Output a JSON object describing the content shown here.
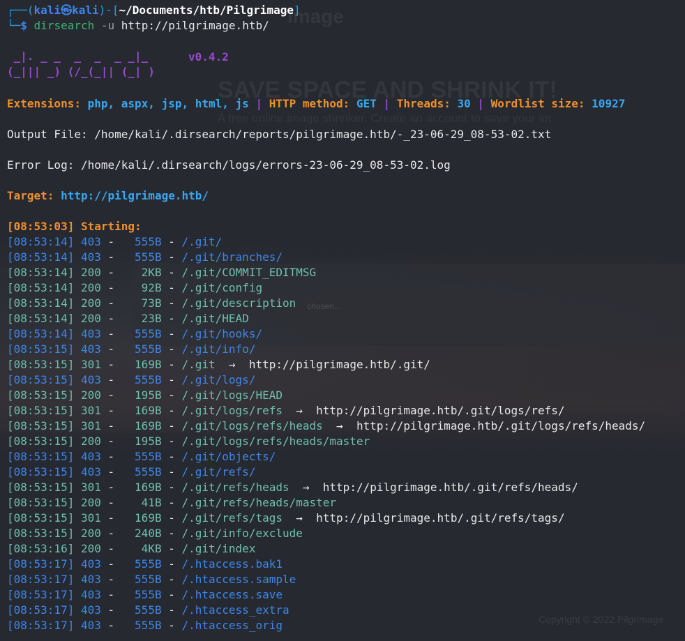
{
  "background": {
    "brand": "image",
    "heading": "SAVE SPACE AND SHRINK IT!",
    "subheading": "A free online image shrinker. Create an account to save your im",
    "file_hint": "chosen...",
    "copyright": "Copyright © 2022 Pilgrimage"
  },
  "prompt": {
    "box_top": "┌──(",
    "user_host": "kali㉿kali",
    "mid": ")-[",
    "path": "~/Documents/htb/Pilgrimage",
    "end": "]",
    "box_bottom": "└─",
    "dollar": "$",
    "command": "dirsearch",
    "flag": "-u",
    "url": "http://pilgrimage.htb/"
  },
  "logo": {
    "line1": " _|. _ _  _  _  _ _|_",
    "line2": "(_||| _) (/_(_|| (_| )",
    "version": "v0.4.2"
  },
  "config": {
    "ext_label": "Extensions:",
    "ext_value": "php, aspx, jsp, html, js",
    "sep": "|",
    "method_label": "HTTP method:",
    "method_value": "GET",
    "threads_label": "Threads:",
    "threads_value": "30",
    "wordlist_label": "Wordlist size:",
    "wordlist_value": "10927"
  },
  "output_file": "Output File: /home/kali/.dirsearch/reports/pilgrimage.htb/-_23-06-29_08-53-02.txt",
  "error_log": "Error Log: /home/kali/.dirsearch/logs/errors-23-06-29_08-53-02.log",
  "target": {
    "label": "Target:",
    "url": "http://pilgrimage.htb/"
  },
  "starting": "[08:53:03] Starting:",
  "results": [
    {
      "time": "[08:53:14]",
      "code": "403",
      "size": "555B",
      "path": "/.git/",
      "redirect": ""
    },
    {
      "time": "[08:53:14]",
      "code": "403",
      "size": "555B",
      "path": "/.git/branches/",
      "redirect": ""
    },
    {
      "time": "[08:53:14]",
      "code": "200",
      "size": "2KB",
      "path": "/.git/COMMIT_EDITMSG",
      "redirect": ""
    },
    {
      "time": "[08:53:14]",
      "code": "200",
      "size": "92B",
      "path": "/.git/config",
      "redirect": ""
    },
    {
      "time": "[08:53:14]",
      "code": "200",
      "size": "73B",
      "path": "/.git/description",
      "redirect": ""
    },
    {
      "time": "[08:53:14]",
      "code": "200",
      "size": "23B",
      "path": "/.git/HEAD",
      "redirect": ""
    },
    {
      "time": "[08:53:14]",
      "code": "403",
      "size": "555B",
      "path": "/.git/hooks/",
      "redirect": ""
    },
    {
      "time": "[08:53:15]",
      "code": "403",
      "size": "555B",
      "path": "/.git/info/",
      "redirect": ""
    },
    {
      "time": "[08:53:15]",
      "code": "301",
      "size": "169B",
      "path": "/.git",
      "redirect": "http://pilgrimage.htb/.git/"
    },
    {
      "time": "[08:53:15]",
      "code": "403",
      "size": "555B",
      "path": "/.git/logs/",
      "redirect": ""
    },
    {
      "time": "[08:53:15]",
      "code": "200",
      "size": "195B",
      "path": "/.git/logs/HEAD",
      "redirect": ""
    },
    {
      "time": "[08:53:15]",
      "code": "301",
      "size": "169B",
      "path": "/.git/logs/refs",
      "redirect": "http://pilgrimage.htb/.git/logs/refs/"
    },
    {
      "time": "[08:53:15]",
      "code": "301",
      "size": "169B",
      "path": "/.git/logs/refs/heads",
      "redirect": "http://pilgrimage.htb/.git/logs/refs/heads/"
    },
    {
      "time": "[08:53:15]",
      "code": "200",
      "size": "195B",
      "path": "/.git/logs/refs/heads/master",
      "redirect": ""
    },
    {
      "time": "[08:53:15]",
      "code": "403",
      "size": "555B",
      "path": "/.git/objects/",
      "redirect": ""
    },
    {
      "time": "[08:53:15]",
      "code": "403",
      "size": "555B",
      "path": "/.git/refs/",
      "redirect": ""
    },
    {
      "time": "[08:53:15]",
      "code": "301",
      "size": "169B",
      "path": "/.git/refs/heads",
      "redirect": "http://pilgrimage.htb/.git/refs/heads/"
    },
    {
      "time": "[08:53:15]",
      "code": "200",
      "size": "41B",
      "path": "/.git/refs/heads/master",
      "redirect": ""
    },
    {
      "time": "[08:53:15]",
      "code": "301",
      "size": "169B",
      "path": "/.git/refs/tags",
      "redirect": "http://pilgrimage.htb/.git/refs/tags/"
    },
    {
      "time": "[08:53:15]",
      "code": "200",
      "size": "240B",
      "path": "/.git/info/exclude",
      "redirect": ""
    },
    {
      "time": "[08:53:16]",
      "code": "200",
      "size": "4KB",
      "path": "/.git/index",
      "redirect": ""
    },
    {
      "time": "[08:53:17]",
      "code": "403",
      "size": "555B",
      "path": "/.htaccess.bak1",
      "redirect": ""
    },
    {
      "time": "[08:53:17]",
      "code": "403",
      "size": "555B",
      "path": "/.htaccess.sample",
      "redirect": ""
    },
    {
      "time": "[08:53:17]",
      "code": "403",
      "size": "555B",
      "path": "/.htaccess.save",
      "redirect": ""
    },
    {
      "time": "[08:53:17]",
      "code": "403",
      "size": "555B",
      "path": "/.htaccess_extra",
      "redirect": ""
    },
    {
      "time": "[08:53:17]",
      "code": "403",
      "size": "555B",
      "path": "/.htaccess_orig",
      "redirect": ""
    }
  ],
  "colors": {
    "code_403": "#3e86e8",
    "code_200": "#6fbfb0",
    "code_301": "#6fbfb0",
    "accent_orange": "#f0902a",
    "accent_cyan": "#39a7f0",
    "accent_purple": "#9a47d4"
  }
}
